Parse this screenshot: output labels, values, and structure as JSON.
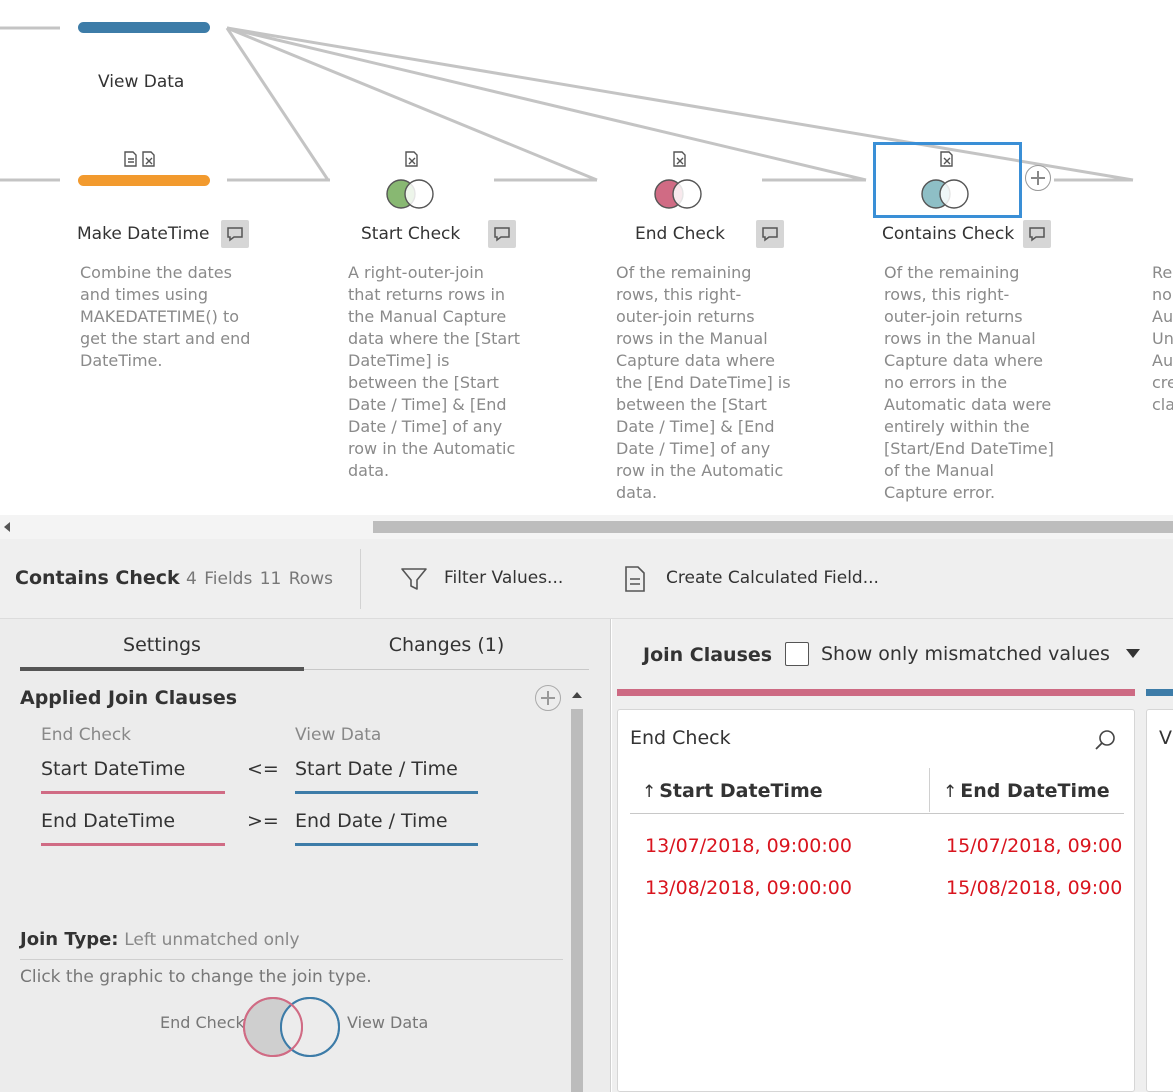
{
  "flow": {
    "view_data": {
      "label": "View Data",
      "color": "#3d7ca8"
    },
    "nodes": [
      {
        "label": "Make DateTime",
        "color": "#f29a2e",
        "description": [
          "Combine the dates",
          "and times using",
          "MAKEDATETIME() to",
          "get the start and end",
          "DateTime."
        ]
      },
      {
        "label": "Start Check",
        "venn_color": "#88b872",
        "description": [
          "A right-outer-join",
          "that returns rows in",
          "the Manual Capture",
          "data where the [Start",
          "DateTime] is",
          "between the [Start",
          "Date / Time] & [End",
          "Date / Time] of any",
          "row in the Automatic",
          "data."
        ]
      },
      {
        "label": "End Check",
        "venn_color": "#d06b84",
        "description": [
          "Of the remaining",
          "rows, this right-",
          "outer-join returns",
          "rows in the Manual",
          "Capture data where",
          "the [End DateTime] is",
          "between the [Start",
          "Date / Time] & [End",
          "Date / Time] of any",
          "row in the Automatic",
          "data."
        ]
      },
      {
        "label": "Contains Check",
        "venn_color": "#8ebfc6",
        "selected": true,
        "description": [
          "Of the remaining",
          "rows, this right-",
          "outer-join returns",
          "rows in the Manual",
          "Capture data where",
          "no errors in the",
          "Automatic data were",
          "entirely within the",
          "[Start/End DateTime]",
          "of the Manual",
          "Capture error."
        ]
      }
    ],
    "partial_description": [
      "Re",
      "no",
      "Au",
      "Un",
      "Au",
      "cre",
      "cla"
    ]
  },
  "toolbar": {
    "step_name": "Contains Check",
    "counts": "4 Fields  11 Rows",
    "filter_label": "Filter Values...",
    "calc_label": "Create Calculated Field..."
  },
  "settings": {
    "tab_settings": "Settings",
    "tab_changes": "Changes (1)",
    "section_title": "Applied Join Clauses",
    "left_source": "End Check",
    "right_source": "View Data",
    "clauses": [
      {
        "left": "Start DateTime",
        "op": "<=",
        "right": "Start Date / Time"
      },
      {
        "left": "End DateTime",
        "op": ">=",
        "right": "End Date / Time"
      }
    ],
    "join_type_label": "Join Type:",
    "join_type_value": "Left unmatched only",
    "join_help": "Click the graphic to change the join type.",
    "venn_left": "End Check",
    "venn_right": "View Data"
  },
  "join_panel": {
    "title": "Join Clauses",
    "checkbox_label": "Show only mismatched values",
    "card_title": "End Check",
    "card2_title": "V",
    "columns": [
      "Start DateTime",
      "End DateTime"
    ],
    "rows": [
      [
        "13/07/2018, 09:00:00",
        "15/07/2018, 09:00:00"
      ],
      [
        "13/08/2018, 09:00:00",
        "15/08/2018, 09:00:00"
      ]
    ],
    "mismatch_color": "#d9141e"
  }
}
